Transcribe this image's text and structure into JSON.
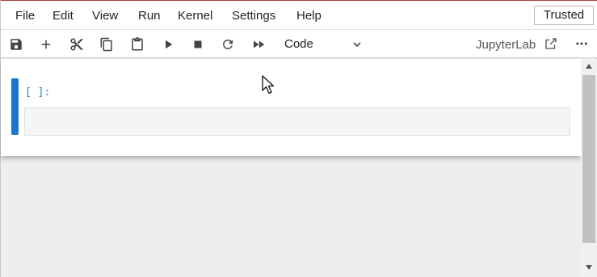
{
  "menu": {
    "items": [
      "File",
      "Edit",
      "View",
      "Run",
      "Kernel",
      "Settings",
      "Help"
    ]
  },
  "status": {
    "trusted_label": "Trusted"
  },
  "toolbar": {
    "buttons": [
      "save-icon",
      "add-icon",
      "cut-icon",
      "copy-icon",
      "paste-icon",
      "run-icon",
      "stop-icon",
      "restart-icon",
      "fast-forward-icon"
    ],
    "cell_type": "Code",
    "kernel_label": "JupyterLab"
  },
  "cell": {
    "prompt": "[ ]:",
    "source": ""
  },
  "colors": {
    "accent": "#1976d2",
    "prompt": "#307fc1",
    "top_border": "#b23b3b"
  }
}
